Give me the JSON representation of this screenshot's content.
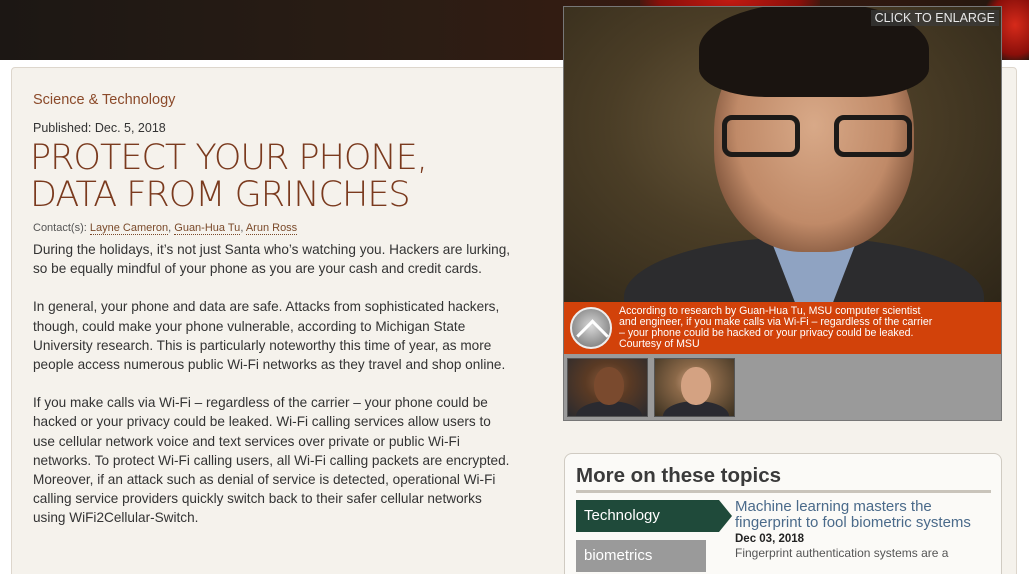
{
  "article": {
    "category": "Science & Technology",
    "published": "Published: Dec. 5, 2018",
    "headline_line1": "PROTECT YOUR PHONE,",
    "headline_line2": "DATA FROM GRINCHES",
    "contacts_label": "Contact(s):",
    "contacts": [
      "Layne Cameron",
      "Guan-Hua Tu",
      "Arun Ross"
    ],
    "paragraphs": [
      "During the holidays, it’s not just Santa who’s watching you. Hackers are lurking, so be equally mindful of your phone as you are your cash and credit cards.",
      "In general, your phone and data are safe. Attacks from sophisticated hackers, though, could make your phone vulnerable, according to Michigan State University research. This is particularly noteworthy this time of year, as more people access numerous public Wi-Fi networks as they travel and shop online.",
      "If you make calls via Wi-Fi – regardless of the carrier – your phone could be hacked or your privacy could be leaked. Wi-Fi calling services allow users to use cellular network voice and text services over private or public Wi-Fi networks. To protect Wi-Fi calling users, all Wi-Fi calling packets are encrypted. Moreover, if an attack such as denial of service is detected, operational Wi-Fi calling service providers quickly switch back to their safer cellular networks using WiFi2Cellular-Switch."
    ]
  },
  "photo": {
    "enlarge_label": "CLICK TO ENLARGE",
    "caption_line1": "According to research by Guan-Hua Tu, MSU computer scientist",
    "caption_line2": "and engineer, if you make calls via Wi-Fi – regardless of the carrier",
    "caption_line3": "– your phone could be hacked or your privacy could be leaked.",
    "caption_line4": "Courtesy of MSU",
    "caption_bg": "#d2420a"
  },
  "topics": {
    "title": "More on these topics",
    "tags": [
      "Technology",
      "biometrics"
    ],
    "active_color": "#1f4a3a",
    "related": {
      "title": "Machine learning masters the fingerprint to fool biometric systems",
      "date": "Dec 03, 2018",
      "excerpt": "Fingerprint authentication systems are a"
    }
  },
  "icons": [
    "chevron-up-icon"
  ]
}
